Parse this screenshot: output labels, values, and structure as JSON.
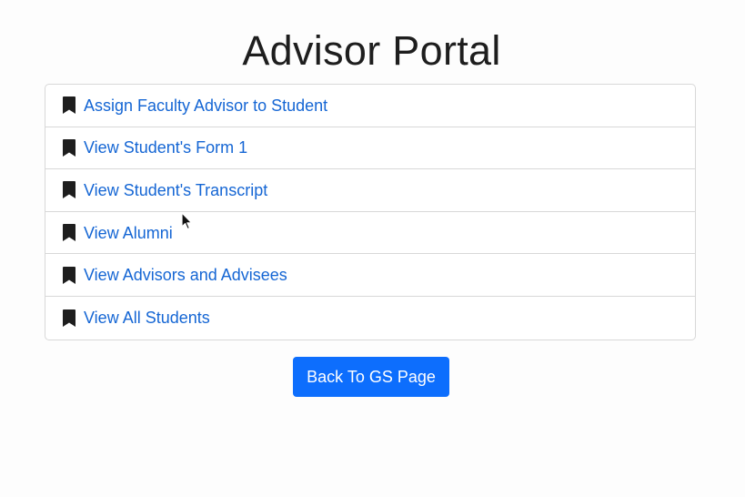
{
  "page": {
    "title": "Advisor Portal"
  },
  "menu": {
    "items": [
      {
        "label": "Assign Faculty Advisor to Student",
        "icon": "bookmark-icon"
      },
      {
        "label": "View Student's Form 1",
        "icon": "bookmark-icon"
      },
      {
        "label": "View Student's Transcript",
        "icon": "bookmark-icon"
      },
      {
        "label": "View Alumni",
        "icon": "bookmark-icon"
      },
      {
        "label": "View Advisors and Advisees",
        "icon": "bookmark-icon"
      },
      {
        "label": "View All Students",
        "icon": "bookmark-icon"
      }
    ]
  },
  "actions": {
    "back_label": "Back To GS Page"
  },
  "colors": {
    "link": "#1566d4",
    "primary_button": "#0d6efd",
    "icon": "#1e1e1e"
  }
}
